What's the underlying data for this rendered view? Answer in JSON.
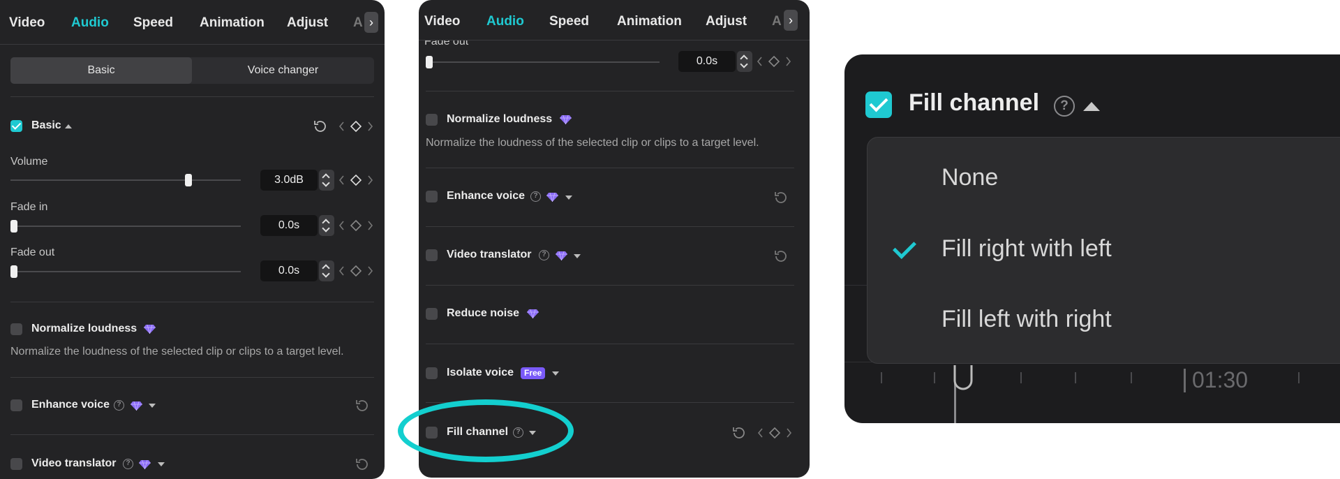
{
  "tabs": {
    "video": "Video",
    "audio": "Audio",
    "speed": "Speed",
    "animation": "Animation",
    "adjust": "Adjust",
    "overflow": "A",
    "more_glyph": "›"
  },
  "panel1": {
    "segment": {
      "basic": "Basic",
      "voice_changer": "Voice changer"
    },
    "basic_label": "Basic",
    "volume": {
      "label": "Volume",
      "value": "3.0dB",
      "level": 0.78
    },
    "fade_in": {
      "label": "Fade in",
      "value": "0.0s",
      "level": 0
    },
    "fade_out": {
      "label": "Fade out",
      "value": "0.0s",
      "level": 0
    },
    "normalize": {
      "label": "Normalize loudness",
      "description": "Normalize the loudness of the selected clip or clips to a target level."
    },
    "enhance_voice": "Enhance voice",
    "video_translator": "Video translator"
  },
  "panel2": {
    "fade_out": {
      "label": "Fade out",
      "value": "0.0s"
    },
    "normalize": {
      "label": "Normalize loudness",
      "description": "Normalize the loudness of the selected clip or clips to a target level."
    },
    "enhance_voice": "Enhance voice",
    "video_translator": "Video translator",
    "reduce_noise": "Reduce noise",
    "isolate_voice": "Isolate voice",
    "free_badge": "Free",
    "fill_channel": "Fill channel"
  },
  "zoom": {
    "title": "Fill channel",
    "help_glyph": "?",
    "options": [
      "None",
      "Fill right with left",
      "Fill left with right"
    ],
    "selected_index": 1,
    "timeline_time": "01:30"
  },
  "help_glyph": "?",
  "colors": {
    "accent": "#1fc9d1",
    "premium": "#8b6cf6",
    "highlight_ring": "#13cfcf"
  }
}
